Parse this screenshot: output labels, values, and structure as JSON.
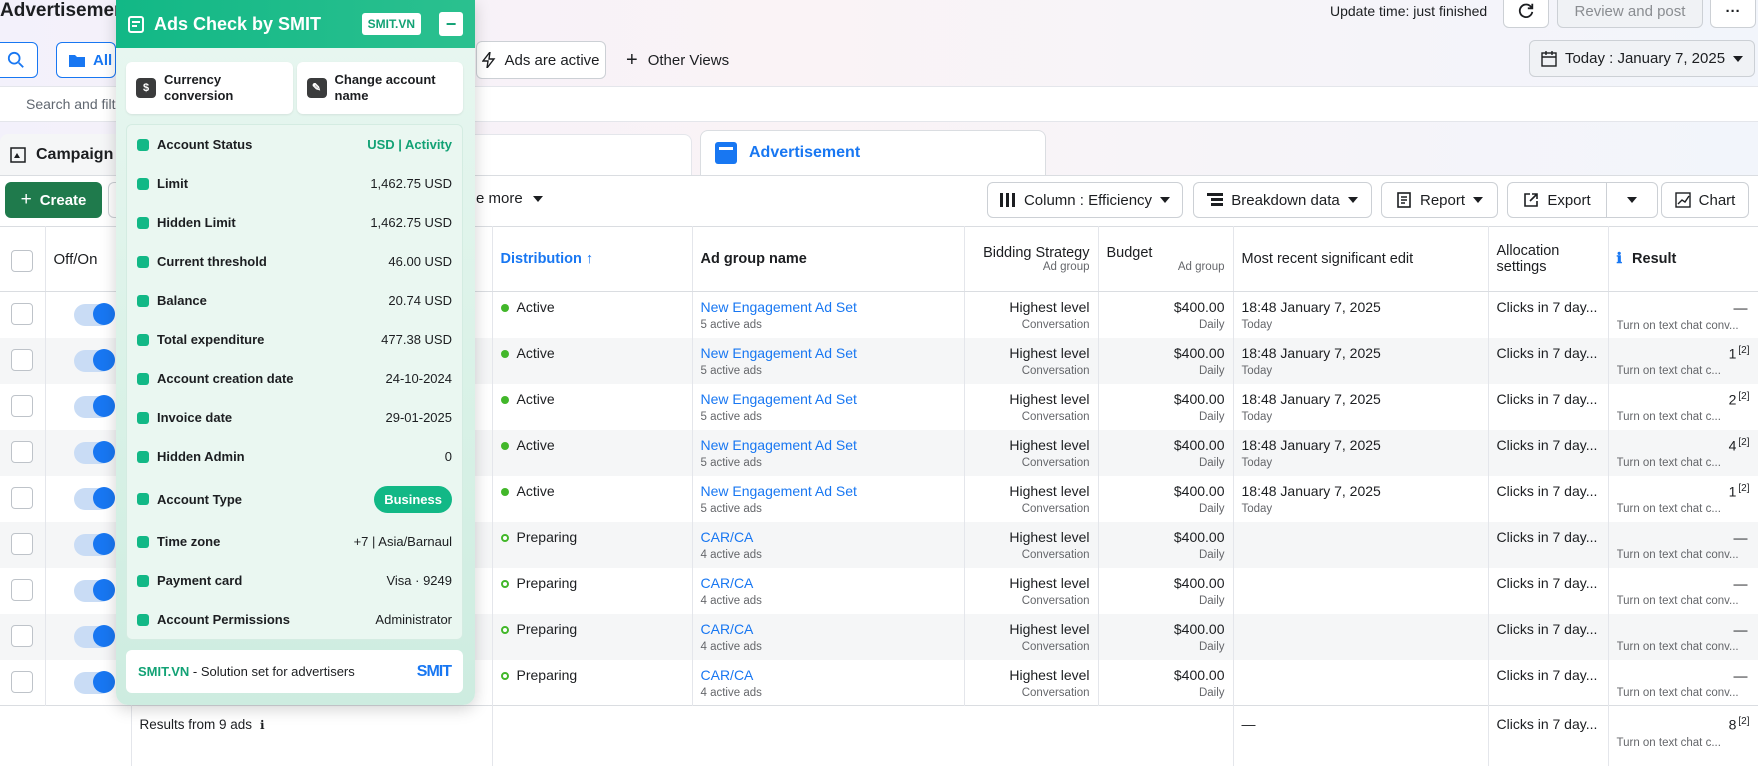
{
  "header": {
    "title": "Advertisement",
    "update_time": "Update time: just finished",
    "review_post": "Review and post",
    "more": "···"
  },
  "filters": {
    "all_label": "All",
    "ads_active": "Ads are active",
    "other_views": "Other Views",
    "date_range": "Today : January 7, 2025",
    "search_placeholder": "Search and filt"
  },
  "tabs": {
    "campaign": "Campaign",
    "advertisement": "Advertisement"
  },
  "toolbar": {
    "create": "Create",
    "see_more": "e more",
    "column": "Column : Efficiency",
    "breakdown": "Breakdown data",
    "report": "Report",
    "export": "Export",
    "chart": "Chart"
  },
  "table": {
    "headers": {
      "offon": "Off/On",
      "distribution": "Distribution",
      "ad_group_name": "Ad group name",
      "bidding": "Bidding Strategy",
      "bidding_sub": "Ad group",
      "budget": "Budget",
      "budget_sub": "Ad group",
      "recent_edit": "Most recent significant edit",
      "allocation": "Allocation settings",
      "result": "Result"
    },
    "rows": [
      {
        "status": "Active",
        "name": "New Engagement Ad Set",
        "ads": "5 active ads",
        "bid": "Highest level",
        "bid_sub": "Conversation",
        "budget": "$400.00",
        "budget_sub": "Daily",
        "edit": "18:48 January 7, 2025",
        "edit_sub": "Today",
        "alloc": "Clicks in 7 day...",
        "result": "—",
        "result_sup": "",
        "result_sub": "Turn on text chat conv..."
      },
      {
        "status": "Active",
        "name": "New Engagement Ad Set",
        "ads": "5 active ads",
        "bid": "Highest level",
        "bid_sub": "Conversation",
        "budget": "$400.00",
        "budget_sub": "Daily",
        "edit": "18:48 January 7, 2025",
        "edit_sub": "Today",
        "alloc": "Clicks in 7 day...",
        "result": "1",
        "result_sup": "[2]",
        "result_sub": "Turn on text chat c..."
      },
      {
        "status": "Active",
        "name": "New Engagement Ad Set",
        "ads": "5 active ads",
        "bid": "Highest level",
        "bid_sub": "Conversation",
        "budget": "$400.00",
        "budget_sub": "Daily",
        "edit": "18:48 January 7, 2025",
        "edit_sub": "Today",
        "alloc": "Clicks in 7 day...",
        "result": "2",
        "result_sup": "[2]",
        "result_sub": "Turn on text chat c..."
      },
      {
        "status": "Active",
        "name": "New Engagement Ad Set",
        "ads": "5 active ads",
        "bid": "Highest level",
        "bid_sub": "Conversation",
        "budget": "$400.00",
        "budget_sub": "Daily",
        "edit": "18:48 January 7, 2025",
        "edit_sub": "Today",
        "alloc": "Clicks in 7 day...",
        "result": "4",
        "result_sup": "[2]",
        "result_sub": "Turn on text chat c..."
      },
      {
        "status": "Active",
        "name": "New Engagement Ad Set",
        "ads": "5 active ads",
        "bid": "Highest level",
        "bid_sub": "Conversation",
        "budget": "$400.00",
        "budget_sub": "Daily",
        "edit": "18:48 January 7, 2025",
        "edit_sub": "Today",
        "alloc": "Clicks in 7 day...",
        "result": "1",
        "result_sup": "[2]",
        "result_sub": "Turn on text chat c..."
      },
      {
        "status": "Preparing",
        "name": "CAR/CA",
        "ads": "4 active ads",
        "bid": "Highest level",
        "bid_sub": "Conversation",
        "budget": "$400.00",
        "budget_sub": "Daily",
        "edit": "",
        "edit_sub": "",
        "alloc": "Clicks in 7 day...",
        "result": "—",
        "result_sup": "",
        "result_sub": "Turn on text chat conv..."
      },
      {
        "status": "Preparing",
        "name": "CAR/CA",
        "ads": "4 active ads",
        "bid": "Highest level",
        "bid_sub": "Conversation",
        "budget": "$400.00",
        "budget_sub": "Daily",
        "edit": "",
        "edit_sub": "",
        "alloc": "Clicks in 7 day...",
        "result": "—",
        "result_sup": "",
        "result_sub": "Turn on text chat conv..."
      },
      {
        "status": "Preparing",
        "name": "CAR/CA",
        "ads": "4 active ads",
        "bid": "Highest level",
        "bid_sub": "Conversation",
        "budget": "$400.00",
        "budget_sub": "Daily",
        "edit": "",
        "edit_sub": "",
        "alloc": "Clicks in 7 day...",
        "result": "—",
        "result_sup": "",
        "result_sub": "Turn on text chat conv..."
      },
      {
        "status": "Preparing",
        "name": "CAR/CA",
        "ads": "4 active ads",
        "bid": "Highest level",
        "bid_sub": "Conversation",
        "budget": "$400.00",
        "budget_sub": "Daily",
        "edit": "",
        "edit_sub": "",
        "alloc": "Clicks in 7 day...",
        "result": "—",
        "result_sup": "",
        "result_sub": "Turn on text chat conv..."
      }
    ],
    "footer": {
      "label": "Results from 9 ads",
      "edit": "—",
      "alloc": "Clicks in 7 day...",
      "result": "8",
      "result_sup": "[2]",
      "result_sub": "Turn on text chat c..."
    }
  },
  "panel": {
    "title": "Ads Check by SMIT",
    "badge": "SMIT.VN",
    "minimize": "−",
    "card_currency": "Currency conversion",
    "card_rename": "Change account name",
    "rows": [
      {
        "label": "Account Status",
        "value": "USD | Activity",
        "color": "#12a275"
      },
      {
        "label": "Limit",
        "value": "1,462.75 USD",
        "color": ""
      },
      {
        "label": "Hidden Limit",
        "value": "1,462.75 USD",
        "color": ""
      },
      {
        "label": "Current threshold",
        "value": "46.00 USD",
        "color": ""
      },
      {
        "label": "Balance",
        "value": "20.74 USD",
        "color": ""
      },
      {
        "label": "Total expenditure",
        "value": "477.38 USD",
        "color": ""
      },
      {
        "label": "Account creation date",
        "value": "24-10-2024",
        "color": ""
      },
      {
        "label": "Invoice date",
        "value": "29-01-2025",
        "color": ""
      },
      {
        "label": "Hidden Admin",
        "value": "0",
        "color": ""
      },
      {
        "label": "Account Type",
        "value": "Business",
        "color": "pill"
      },
      {
        "label": "Time zone",
        "value": "+7 | Asia/Barnaul",
        "color": ""
      },
      {
        "label": "Payment card",
        "value": "Visa · 9249",
        "color": ""
      },
      {
        "label": "Account Permissions",
        "value": "Administrator",
        "color": ""
      }
    ],
    "footer_brand": "SMIT.VN",
    "footer_text": " - Solution set for advertisers",
    "footer_logo": "SMIT",
    "accent": "#12b886"
  }
}
